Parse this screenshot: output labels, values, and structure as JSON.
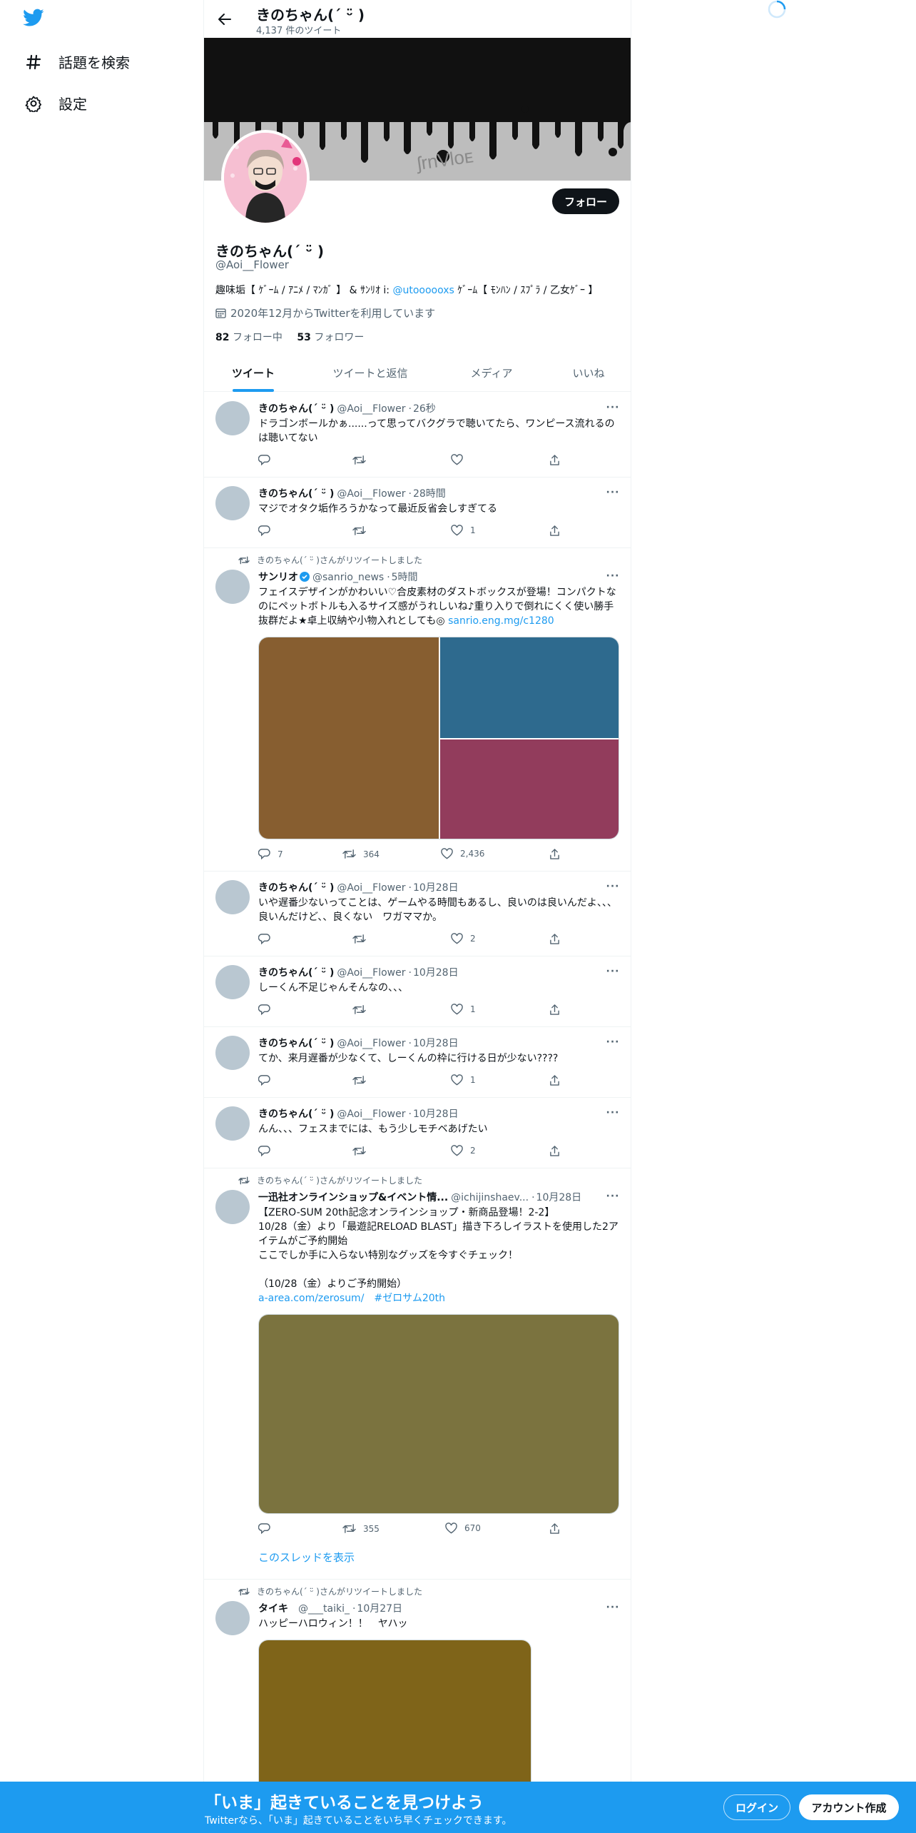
{
  "nav": {
    "items": [
      {
        "label": "話題を検索",
        "icon": "hashtag-icon"
      },
      {
        "label": "設定",
        "icon": "gear-icon"
      }
    ]
  },
  "header": {
    "title": "きのちゃん(´ ᵕ̈ )",
    "tweet_count": "4,137 件のツイート"
  },
  "profile": {
    "name": "きのちゃん(´ ᵕ̈ )",
    "handle": "@Aoi__Flower",
    "bio_pre": "趣味垢【 ｹﾞｰﾑ / ｱﾆﾒ / ﾏﾝｶﾞ 】 & ｻﾝﾘｵ i: ",
    "bio_link": "@utoooooxs",
    "bio_post": " ｹﾞｰﾑ【 ﾓﾝﾊﾝ / ｽﾌﾟﾗ / 乙女ｹﾞｰ 】",
    "joined": "2020年12月からTwitterを利用しています",
    "following_count": "82",
    "following_label": "フォロー中",
    "followers_count": "53",
    "followers_label": "フォロワー",
    "follow_button": "フォロー"
  },
  "tabs": [
    "ツイート",
    "ツイートと返信",
    "メディア",
    "いいね"
  ],
  "tweets": [
    {
      "name": "きのちゃん(´ ᵕ̈ )",
      "handle": "@Aoi__Flower",
      "time": "26秒",
      "text": "ドラゴンボールかぁ......って思ってバクグラで聴いてたら、ワンピース流れるのは聴いてない",
      "replies": "",
      "retweets": "",
      "likes": ""
    },
    {
      "name": "きのちゃん(´ ᵕ̈ )",
      "handle": "@Aoi__Flower",
      "time": "28時間",
      "text": "マジでオタク垢作ろうかなって最近反省会しすぎてる",
      "replies": "",
      "retweets": "",
      "likes": "1"
    },
    {
      "retweeted_by": "きのちゃん(´ ᵕ̈ )さんがリツイートしました",
      "name": "サンリオ",
      "handle": "@sanrio_news",
      "time": "5時間",
      "text": "フェイスデザインがかわいい♡合皮素材のダストボックスが登場！コンパクトなのにペットボトルも入るサイズ感がうれしいね♪重り入りで倒れにくく使い勝手抜群だよ★卓上収納や小物入れとしても◎ ",
      "link": "sanrio.eng.mg/c1280",
      "media_colors": [
        "#875e30",
        "#2e6a8e",
        "#923c5c"
      ],
      "replies": "7",
      "retweets": "364",
      "likes": "2,436"
    },
    {
      "name": "きのちゃん(´ ᵕ̈ )",
      "handle": "@Aoi__Flower",
      "time": "10月28日",
      "text": "いや遅番少ないってことは、ゲームやる時間もあるし、良いのは良いんだよ、、、良いんだけど、、良くない　ワガママか。",
      "replies": "",
      "retweets": "",
      "likes": "2"
    },
    {
      "name": "きのちゃん(´ ᵕ̈ )",
      "handle": "@Aoi__Flower",
      "time": "10月28日",
      "text": "しーくん不足じゃんそんなの、、、",
      "replies": "",
      "retweets": "",
      "likes": "1"
    },
    {
      "name": "きのちゃん(´ ᵕ̈ )",
      "handle": "@Aoi__Flower",
      "time": "10月28日",
      "text": "てか、来月遅番が少なくて、しーくんの枠に行ける日が少ない????",
      "replies": "",
      "retweets": "",
      "likes": "1"
    },
    {
      "name": "きのちゃん(´ ᵕ̈ )",
      "handle": "@Aoi__Flower",
      "time": "10月28日",
      "text": "んん、、、フェスまでには、もう少しモチベあげたい",
      "replies": "",
      "retweets": "",
      "likes": "2"
    },
    {
      "retweeted_by": "きのちゃん(´ ᵕ̈ )さんがリツイートしました",
      "name": "一迅社オンラインショップ&イベント情...",
      "handle": "@ichijinshaev...",
      "time": "10月28日",
      "text": "【ZERO-SUM 20th記念オンラインショップ・新商品登場！2-2】\n10/28（金）より「最遊記RELOAD BLAST」描き下ろしイラストを使用した2アイテムがご予約開始\nここでしか手に入らない特別なグッズを今すぐチェック！\n\n（10/28（金）よりご予約開始）",
      "link": "a-area.com/zerosum/　#ゼロサム20th",
      "media_colors": [
        "#7b733f"
      ],
      "replies": "",
      "retweets": "355",
      "likes": "670",
      "thread_link": "このスレッドを表示"
    },
    {
      "retweeted_by": "きのちゃん(´ ᵕ̈ )さんがリツイートしました",
      "name": "タイキ",
      "handle": "@___taiki_",
      "time": "10月27日",
      "text": "ハッピーハロウィン！！　ヤハッ",
      "media_colors": [
        "#7f6419"
      ]
    }
  ],
  "bottom_banner": {
    "title": "「いま」起きていることを見つけよう",
    "subtitle": "Twitterなら、「いま」起きていることをいち早くチェックできます。",
    "login": "ログイン",
    "signup": "アカウント作成"
  },
  "colors": {
    "accent": "#1d9bf0",
    "text": "#0f1419",
    "muted": "#536471"
  }
}
